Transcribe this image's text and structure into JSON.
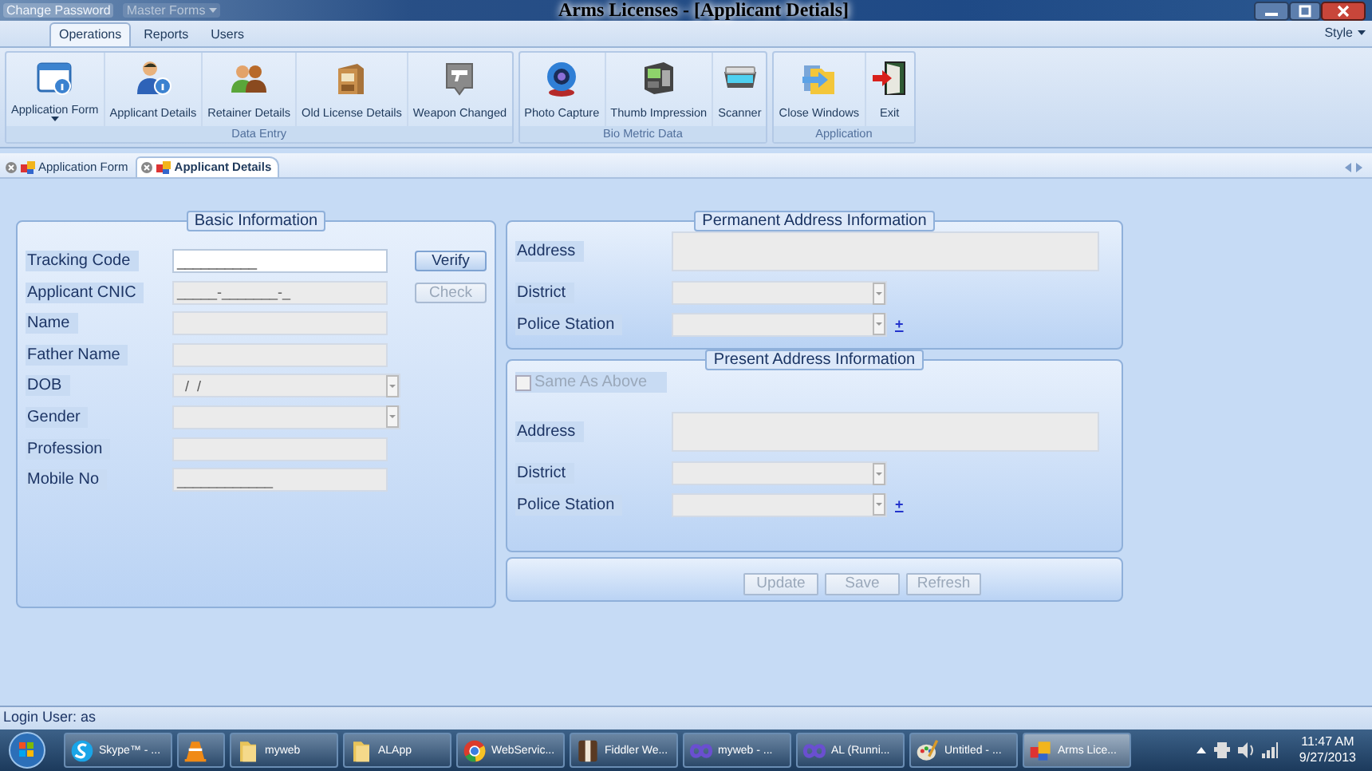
{
  "window": {
    "title": "Arms Licenses - [Applicant Detials]",
    "quick_access": [
      {
        "label": "Change Password",
        "disabled": false
      },
      {
        "label": "Master Forms",
        "disabled": true
      }
    ]
  },
  "ribbon": {
    "tabs": [
      {
        "label": "Operations",
        "selected": true
      },
      {
        "label": "Reports",
        "selected": false
      },
      {
        "label": "Users",
        "selected": false
      }
    ],
    "style_menu": "Style",
    "groups": [
      {
        "label": "Data Entry",
        "buttons": [
          {
            "label": "Application Form",
            "dropdown": true
          },
          {
            "label": "Applicant Details",
            "dropdown": false
          },
          {
            "label": "Retainer Details",
            "dropdown": false
          },
          {
            "label": "Old License Details",
            "dropdown": false
          },
          {
            "label": "Weapon Changed",
            "dropdown": false
          }
        ]
      },
      {
        "label": "Bio Metric Data",
        "buttons": [
          {
            "label": "Photo Capture",
            "dropdown": false
          },
          {
            "label": "Thumb Impression",
            "dropdown": false
          },
          {
            "label": "Scanner",
            "dropdown": false
          }
        ]
      },
      {
        "label": "Application",
        "buttons": [
          {
            "label": "Close Windows",
            "dropdown": false
          },
          {
            "label": "Exit",
            "dropdown": false
          }
        ]
      }
    ]
  },
  "doc_tabs": [
    {
      "label": "Application Form",
      "selected": false
    },
    {
      "label": "Applicant Details",
      "selected": true
    }
  ],
  "basic_info": {
    "title": "Basic Information",
    "fields": [
      {
        "label": "Tracking Code",
        "kind": "text",
        "value": "__________",
        "disabled": false,
        "button": {
          "label": "Verify",
          "disabled": false
        }
      },
      {
        "label": "Applicant CNIC",
        "kind": "text",
        "value": "_____-_______-_",
        "disabled": true,
        "button": {
          "label": "Check",
          "disabled": true
        }
      },
      {
        "label": "Name",
        "kind": "text",
        "disabled": true
      },
      {
        "label": "Father Name",
        "kind": "text",
        "disabled": true
      },
      {
        "label": "DOB",
        "kind": "combo",
        "value": "  /  /",
        "disabled": true
      },
      {
        "label": "Gender",
        "kind": "combo",
        "disabled": true
      },
      {
        "label": "Profession",
        "kind": "text",
        "disabled": true
      },
      {
        "label": "Mobile No",
        "kind": "text",
        "value": "____________",
        "disabled": true
      }
    ]
  },
  "permanent_address": {
    "title": "Permanent Address Information",
    "fields": [
      {
        "label": "Address",
        "kind": "memo",
        "disabled": true
      },
      {
        "label": "District",
        "kind": "combo",
        "disabled": true
      },
      {
        "label": "Police Station",
        "kind": "combo",
        "disabled": true,
        "add_link": "+"
      }
    ]
  },
  "present_address": {
    "title": "Present Address Information",
    "same_as_above": {
      "label": "Same As Above",
      "checked": false,
      "disabled": true
    },
    "fields": [
      {
        "label": "Address",
        "kind": "memo",
        "disabled": true
      },
      {
        "label": "District",
        "kind": "combo",
        "disabled": true
      },
      {
        "label": "Police Station",
        "kind": "combo",
        "disabled": true,
        "add_link": "+"
      }
    ]
  },
  "actions": [
    {
      "label": "Update",
      "disabled": true
    },
    {
      "label": "Save",
      "disabled": true
    },
    {
      "label": "Refresh",
      "disabled": true
    }
  ],
  "status_bar": "Login User: as",
  "taskbar": {
    "items": [
      {
        "label": "Skype™ - ...",
        "selected": false
      },
      {
        "selected": false
      },
      {
        "label": "myweb",
        "selected": false
      },
      {
        "label": "ALApp",
        "selected": false
      },
      {
        "label": "WebServic...",
        "selected": false
      },
      {
        "label": "Fiddler We...",
        "selected": false
      },
      {
        "label": "myweb - ...",
        "selected": false
      },
      {
        "label": "AL (Runni...",
        "selected": false
      },
      {
        "label": "Untitled - ...",
        "selected": false
      },
      {
        "label": "Arms Lice...",
        "selected": true
      }
    ],
    "time": "11:47 AM",
    "date": "9/27/2013"
  }
}
